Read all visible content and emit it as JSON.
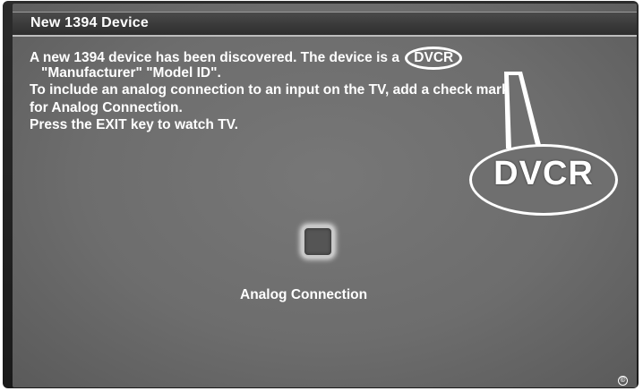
{
  "dialog": {
    "title": "New 1394 Device",
    "message_lines": [
      "A new 1394 device has been discovered. The device is a",
      "\"Manufacturer\" \"Model ID\".",
      "To include an analog connection to an input on the TV, add a check mark",
      "for Analog Connection.",
      "Press the EXIT key to watch TV."
    ],
    "device_type": "DVCR"
  },
  "callout": {
    "label": "DVCR"
  },
  "option": {
    "label": "Analog Connection",
    "checked": false
  },
  "footer": {
    "copyright_symbol": "©"
  },
  "colors": {
    "screen": "#6d6d6d",
    "bezel": "#1a1a1a",
    "text": "#ffffff",
    "title_bar": "#3a3a3a"
  }
}
